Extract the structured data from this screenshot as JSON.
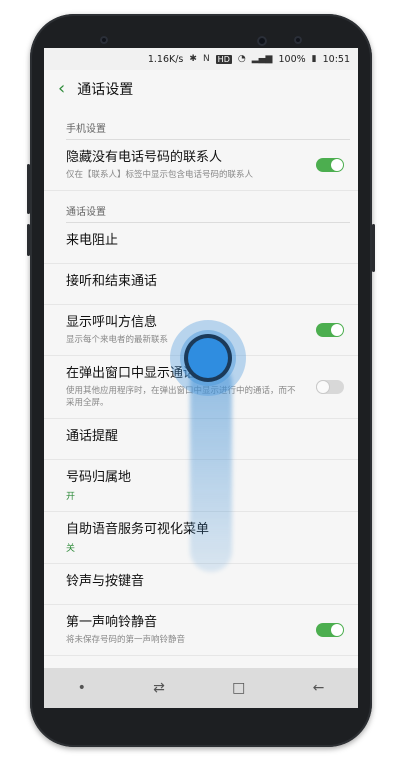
{
  "status": {
    "speed": "1.16K/s",
    "hd": "HD",
    "battery": "100%",
    "time": "10:51"
  },
  "header": {
    "title": "通话设置"
  },
  "sections": {
    "phone": "手机设置",
    "call": "通话设置"
  },
  "items": [
    {
      "title": "隐藏没有电话号码的联系人",
      "sub": "仅在【联系人】标签中显示包含电话号码的联系人",
      "toggle": "on"
    },
    {
      "title": "来电阻止"
    },
    {
      "title": "接听和结束通话"
    },
    {
      "title": "显示呼叫方信息",
      "sub": "显示每个来电者的最新联系",
      "toggle": "on"
    },
    {
      "title": "在弹出窗口中显示通话",
      "sub": "使用其他应用程序时，在弹出窗口中显示进行中的通话，而不采用全屏。",
      "toggle": "off"
    },
    {
      "title": "通话提醒"
    },
    {
      "title": "号码归属地",
      "value": "开"
    },
    {
      "title": "自助语音服务可视化菜单",
      "value": "关"
    },
    {
      "title": "铃声与按键音"
    },
    {
      "title": "第一声响铃静音",
      "sub": "将未保存号码的第一声响铃静音",
      "toggle": "on"
    }
  ],
  "nav": {
    "dot": "•",
    "recent": "⇄",
    "home": "□",
    "back": "←"
  }
}
